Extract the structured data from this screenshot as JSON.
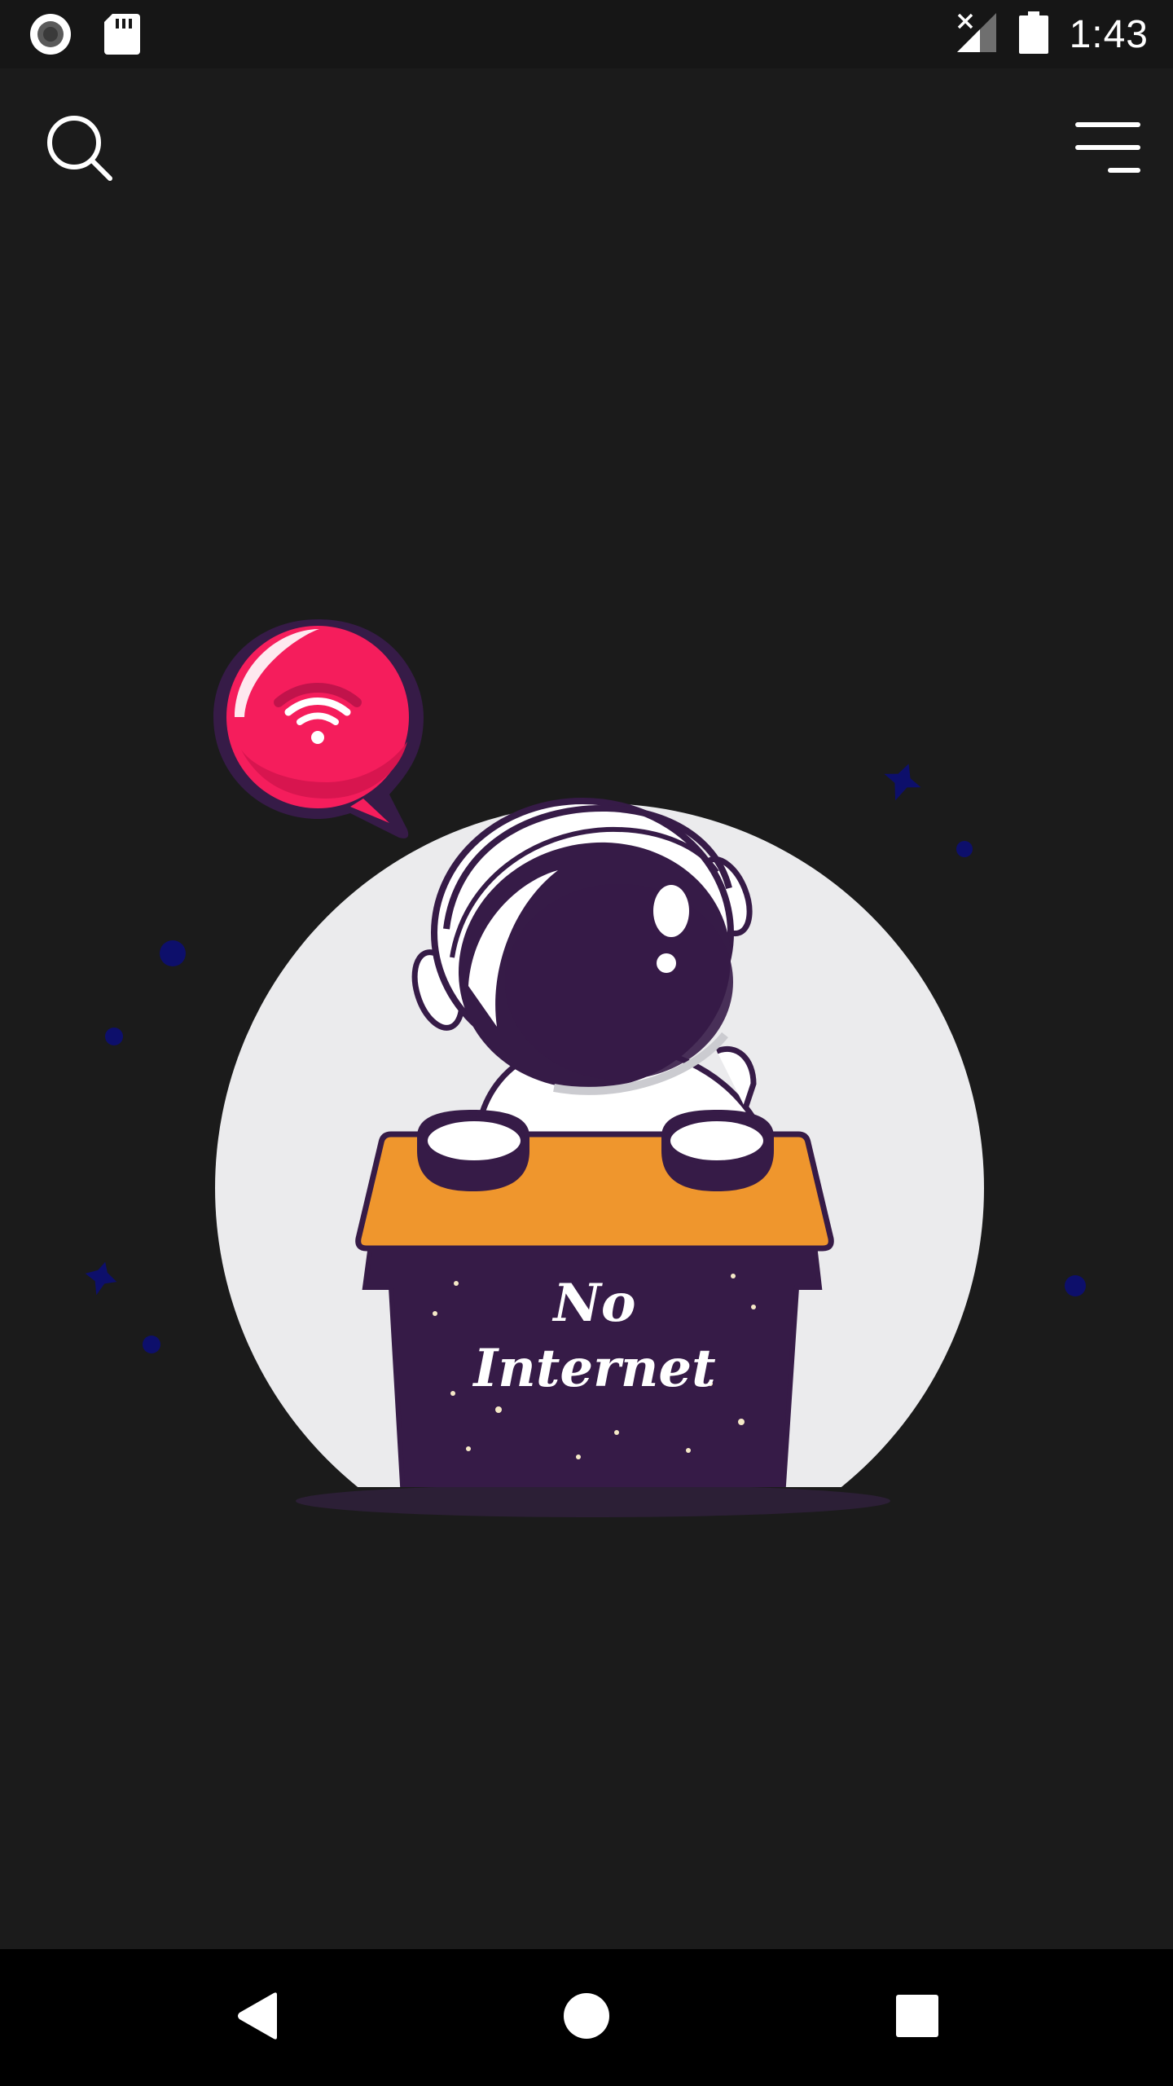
{
  "status_bar": {
    "time": "1:43",
    "left_icons": [
      "record-icon",
      "sd-card-icon"
    ],
    "right_icons": [
      "no-signal-icon",
      "battery-icon"
    ]
  },
  "app_bar": {
    "search_icon": "search-icon",
    "menu_icon": "menu-icon"
  },
  "illustration": {
    "badge_icon": "wifi-icon",
    "sign_line1": "No",
    "sign_line2": "Internet"
  },
  "nav_bar": {
    "buttons": [
      "back-icon",
      "home-icon",
      "recents-icon"
    ]
  },
  "colors": {
    "background": "#1b1b1b",
    "moon": "#ebebed",
    "astronaut_dark": "#361b47",
    "desk_top": "#ef962d",
    "bubble": "#f51d5c",
    "star": "#0d0f6b"
  }
}
